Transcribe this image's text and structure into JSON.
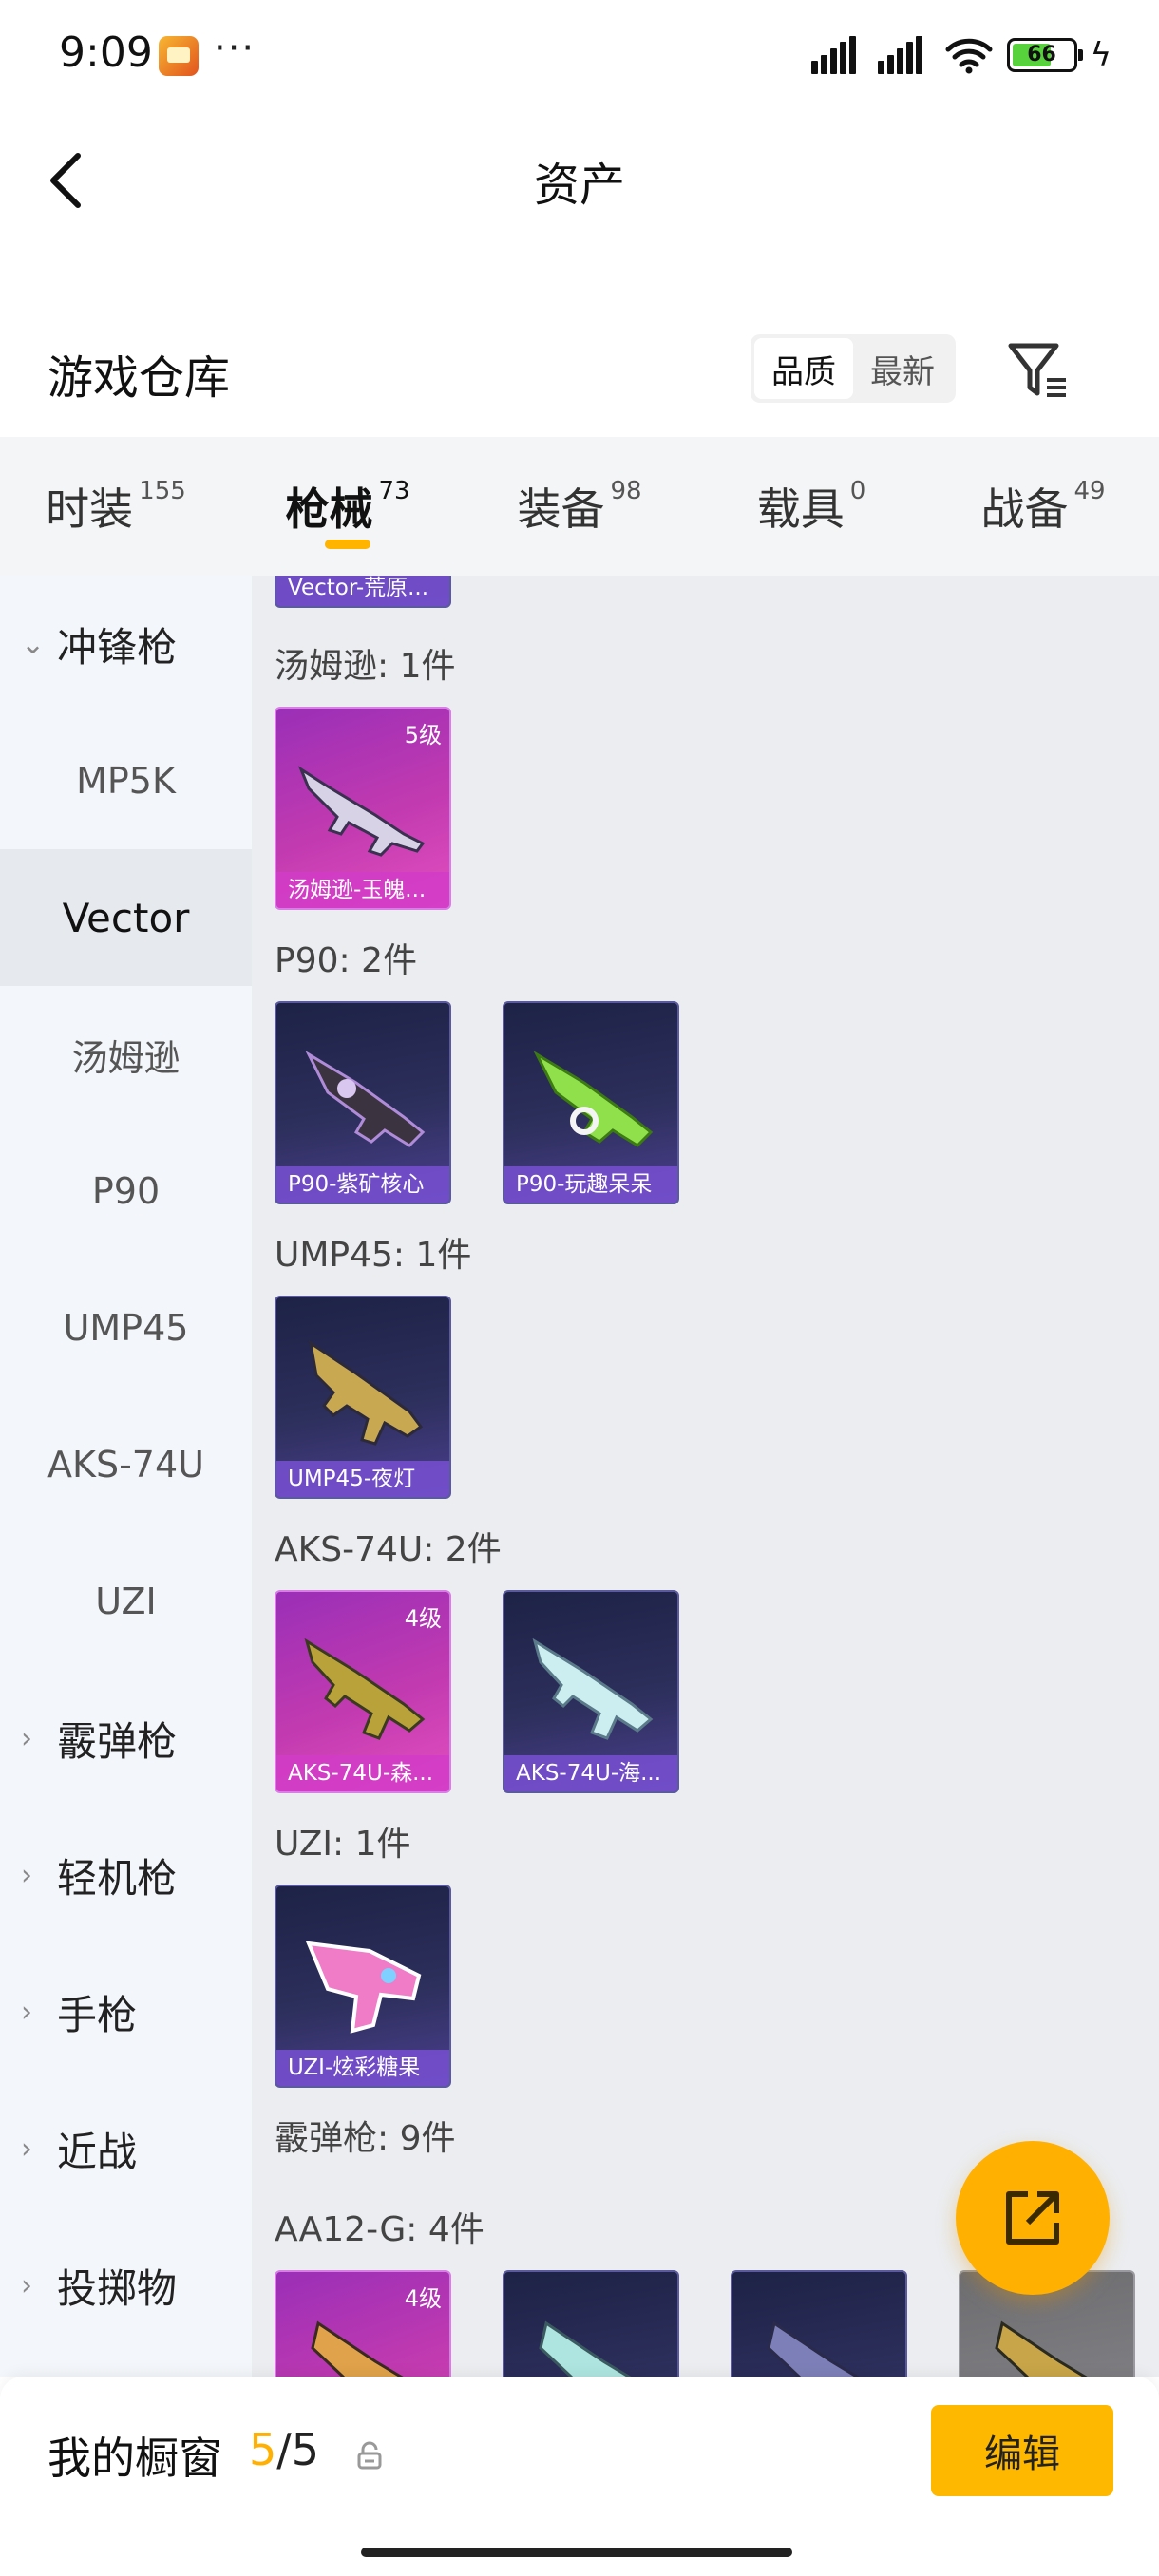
{
  "status_bar": {
    "time": "9:09",
    "dots": "···",
    "battery": "66"
  },
  "header": {
    "title": "资产"
  },
  "section": {
    "title": "游戏仓库",
    "sort_options": [
      "品质",
      "最新"
    ],
    "sort_active": "品质"
  },
  "tabs": [
    {
      "label": "时装",
      "count": "155"
    },
    {
      "label": "枪械",
      "count": "73"
    },
    {
      "label": "装备",
      "count": "98"
    },
    {
      "label": "载具",
      "count": "0"
    },
    {
      "label": "战备",
      "count": "49"
    }
  ],
  "sidebar": {
    "smg_group": "冲锋枪",
    "items": [
      "MP5K",
      "Vector",
      "汤姆逊",
      "P90",
      "UMP45",
      "AKS-74U",
      "UZI"
    ],
    "groups": [
      "霰弹枪",
      "轻机枪",
      "手枪",
      "近战",
      "投掷物"
    ]
  },
  "content": {
    "top_partial_card": "Vector-荒原...",
    "groups": [
      {
        "label": "汤姆逊: 1件",
        "cards": [
          {
            "name": "汤姆逊-玉魄...",
            "level": "5级",
            "rarity": "gold"
          }
        ]
      },
      {
        "label": "P90: 2件",
        "cards": [
          {
            "name": "P90-紫矿核心",
            "level": "",
            "rarity": "purple"
          },
          {
            "name": "P90-玩趣呆呆",
            "level": "",
            "rarity": "purple"
          }
        ]
      },
      {
        "label": "UMP45: 1件",
        "cards": [
          {
            "name": "UMP45-夜灯",
            "level": "",
            "rarity": "purple"
          }
        ]
      },
      {
        "label": "AKS-74U: 2件",
        "cards": [
          {
            "name": "AKS-74U-森...",
            "level": "4级",
            "rarity": "gold"
          },
          {
            "name": "AKS-74U-海...",
            "level": "",
            "rarity": "purple"
          }
        ]
      },
      {
        "label": "UZI: 1件",
        "cards": [
          {
            "name": "UZI-炫彩糖果",
            "level": "",
            "rarity": "purple"
          }
        ]
      }
    ],
    "shotgun_label": "霰弹枪: 9件",
    "aa12_label": "AA12-G: 4件",
    "aa12_first_level": "4级"
  },
  "bottom": {
    "showcase_label": "我的橱窗",
    "current": "5",
    "separator": "/",
    "total": "5",
    "edit_label": "编辑"
  },
  "colors": {
    "accent": "#ffb400",
    "sidebar_bg": "#f3f6fa",
    "content_bg": "#ebedf0"
  }
}
